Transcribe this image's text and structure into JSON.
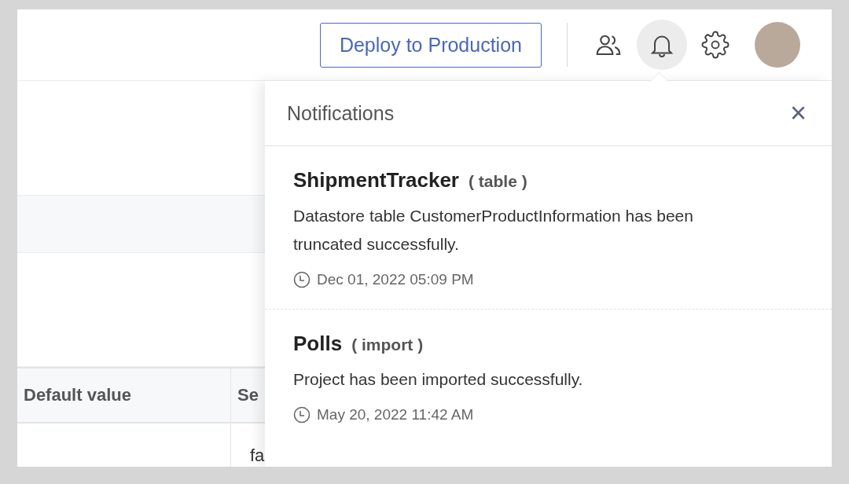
{
  "header": {
    "deploy_button": "Deploy to Production",
    "bell_active": true
  },
  "table": {
    "columns": [
      "Default value",
      "Se"
    ],
    "rows": [
      [
        "",
        "fa"
      ]
    ]
  },
  "notifications": {
    "title": "Notifications",
    "close": "×",
    "items": [
      {
        "name": "ShipmentTracker",
        "type": "( table )",
        "message": "Datastore table CustomerProductInformation has been truncated successfully.",
        "time": "Dec 01, 2022 05:09 PM"
      },
      {
        "name": "Polls",
        "type": "( import )",
        "message": "Project has been imported successfully.",
        "time": "May 20, 2022 11:42 AM"
      }
    ]
  }
}
